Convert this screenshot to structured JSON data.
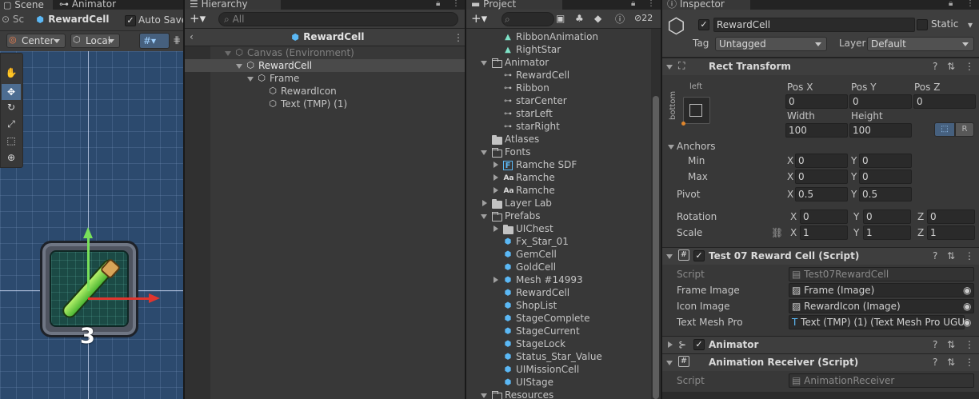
{
  "scene": {
    "tab_scene": "Scene",
    "tab_animator": "Animator",
    "sc_label": "Sc",
    "selection": "RewardCell",
    "auto_save": "Auto Save",
    "pivot_mode": "Center",
    "pivot_space": "Local",
    "badge_number": "3",
    "icons": [
      "hand-icon",
      "move-icon",
      "rotate-icon",
      "scale-icon",
      "rect-icon",
      "transform-icon"
    ]
  },
  "hierarchy": {
    "tab": "Hierarchy",
    "search_placeholder": "All",
    "title": "RewardCell",
    "items": [
      {
        "label": "Canvas (Environment)"
      },
      {
        "label": "RewardCell"
      },
      {
        "label": "Frame"
      },
      {
        "label": "RewardIcon"
      },
      {
        "label": "Text (TMP) (1)"
      }
    ]
  },
  "project": {
    "tab": "Project",
    "hidden_count": "22",
    "items": [
      {
        "label": "RibbonAnimation",
        "icon": "animation-clip-icon"
      },
      {
        "label": "RightStar",
        "icon": "animation-clip-icon"
      },
      {
        "label": "Animator",
        "icon": "folder-open-icon"
      },
      {
        "label": "RewardCell",
        "icon": "animator-controller-icon"
      },
      {
        "label": "Ribbon",
        "icon": "animator-controller-icon"
      },
      {
        "label": "starCenter",
        "icon": "animator-controller-icon"
      },
      {
        "label": "starLeft",
        "icon": "animator-controller-icon"
      },
      {
        "label": "starRight",
        "icon": "animator-controller-icon"
      },
      {
        "label": "Atlases",
        "icon": "folder-icon"
      },
      {
        "label": "Fonts",
        "icon": "folder-open-icon"
      },
      {
        "label": "Ramche SDF",
        "icon": "font-asset-icon"
      },
      {
        "label": "Ramche",
        "icon": "font-icon"
      },
      {
        "label": "Ramche",
        "icon": "font-icon"
      },
      {
        "label": "Layer Lab",
        "icon": "folder-icon"
      },
      {
        "label": "Prefabs",
        "icon": "folder-open-icon"
      },
      {
        "label": "UIChest",
        "icon": "folder-icon"
      },
      {
        "label": "Fx_Star_01",
        "icon": "prefab-icon"
      },
      {
        "label": "GemCell",
        "icon": "prefab-icon"
      },
      {
        "label": "GoldCell",
        "icon": "prefab-icon"
      },
      {
        "label": "Mesh #14993",
        "icon": "prefab-icon"
      },
      {
        "label": "RewardCell",
        "icon": "prefab-icon"
      },
      {
        "label": "ShopList",
        "icon": "prefab-icon"
      },
      {
        "label": "StageComplete",
        "icon": "prefab-icon"
      },
      {
        "label": "StageCurrent",
        "icon": "prefab-icon"
      },
      {
        "label": "StageLock",
        "icon": "prefab-icon"
      },
      {
        "label": "Status_Star_Value",
        "icon": "prefab-icon"
      },
      {
        "label": "UIMissionCell",
        "icon": "prefab-icon"
      },
      {
        "label": "UIStage",
        "icon": "prefab-icon"
      },
      {
        "label": "Resources",
        "icon": "folder-open-icon"
      }
    ]
  },
  "inspector": {
    "tab": "Inspector",
    "object_name": "RewardCell",
    "static_label": "Static",
    "tag_label": "Tag",
    "tag_value": "Untagged",
    "layer_label": "Layer",
    "layer_value": "Default",
    "rect_transform": {
      "title": "Rect Transform",
      "anchor_left": "left",
      "anchor_bottom": "bottom",
      "pos_x_label": "Pos X",
      "pos_y_label": "Pos Y",
      "pos_z_label": "Pos Z",
      "pos_x": "0",
      "pos_y": "0",
      "pos_z": "0",
      "width_label": "Width",
      "height_label": "Height",
      "width": "100",
      "height": "100",
      "r_button": "R",
      "anchors_label": "Anchors",
      "min_label": "Min",
      "max_label": "Max",
      "x_label": "X",
      "y_label": "Y",
      "z_label": "Z",
      "min_x": "0",
      "min_y": "0",
      "max_x": "0",
      "max_y": "0",
      "pivot_label": "Pivot",
      "pivot_x": "0.5",
      "pivot_y": "0.5",
      "rotation_label": "Rotation",
      "rot_x": "0",
      "rot_y": "0",
      "rot_z": "0",
      "scale_label": "Scale",
      "scale_x": "1",
      "scale_y": "1",
      "scale_z": "1"
    },
    "reward_script": {
      "title": "Test 07 Reward Cell (Script)",
      "script_label": "Script",
      "script_value": "Test07RewardCell",
      "frame_label": "Frame Image",
      "frame_value": "Frame (Image)",
      "icon_label": "Icon Image",
      "icon_value": "RewardIcon (Image)",
      "text_label": "Text Mesh Pro",
      "text_value": "Text (TMP) (1) (Text Mesh Pro UGU"
    },
    "animator": {
      "title": "Animator"
    },
    "anim_receiver": {
      "title": "Animation Receiver (Script)",
      "script_label": "Script",
      "script_value": "AnimationReceiver"
    }
  }
}
